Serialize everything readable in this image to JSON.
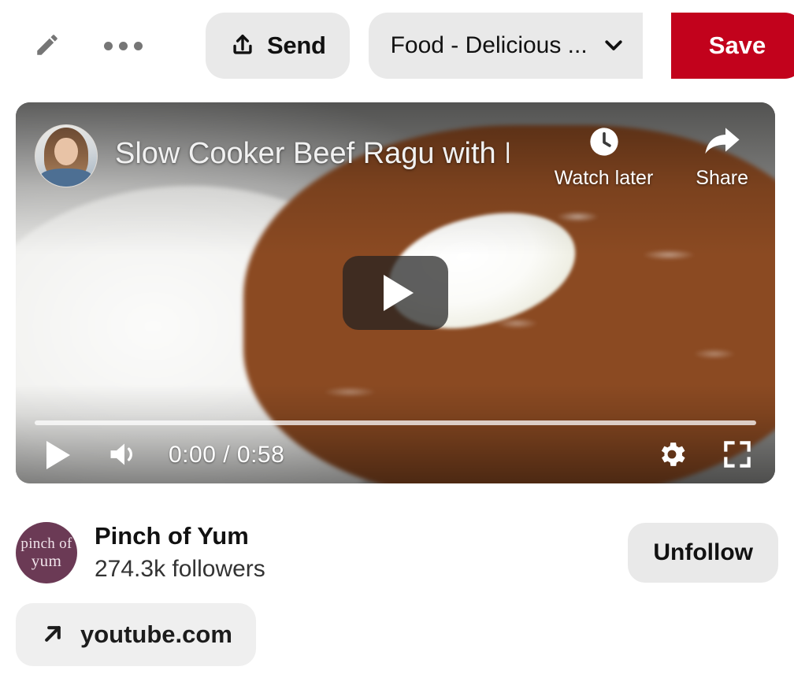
{
  "topbar": {
    "edit_icon": "pencil-icon",
    "more_icon": "ellipsis-icon",
    "send_label": "Send",
    "send_icon": "share-upload-icon",
    "board_name": "Food - Delicious ...",
    "board_chevron_icon": "chevron-down-icon",
    "save_label": "Save",
    "save_color": "#c2021c",
    "pill_bg": "#e9e9e9"
  },
  "video": {
    "title": "Slow Cooker Beef Ragu with P...",
    "channel_avatar": "channel-avatar",
    "watch_later_label": "Watch later",
    "watch_later_icon": "clock-icon",
    "share_label": "Share",
    "share_icon": "share-arrow-icon",
    "play_icon": "play-icon",
    "current_time": "0:00",
    "time_separator": "/",
    "duration": "0:58",
    "time_display": "0:00 / 0:58",
    "volume_icon": "volume-icon",
    "settings_icon": "gear-icon",
    "fullscreen_icon": "fullscreen-icon",
    "progress_percent": 0
  },
  "creator": {
    "avatar_line1": "pinch of",
    "avatar_line2": "yum",
    "avatar_color": "#6b3a55",
    "name": "Pinch of Yum",
    "followers": "274.3k followers",
    "follow_button_label": "Unfollow"
  },
  "source": {
    "label": "youtube.com",
    "icon": "external-link-arrow-icon"
  }
}
